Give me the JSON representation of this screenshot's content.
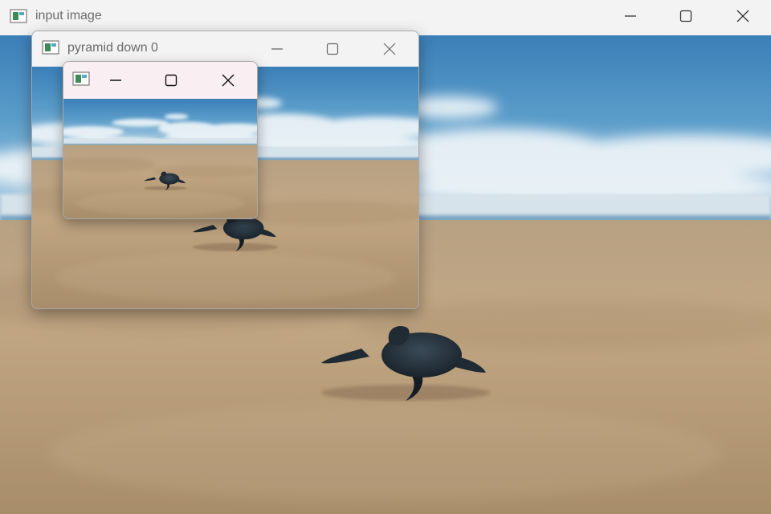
{
  "windows": {
    "main": {
      "title": "input image"
    },
    "pyramid0": {
      "title": "pyramid down 0"
    },
    "pyramid1": {
      "title": ""
    }
  },
  "controls": {
    "minimize": "minimize",
    "maximize": "maximize",
    "close": "close"
  },
  "icons": {
    "app": "image-window-icon",
    "minimize": "minimize-icon",
    "maximize": "maximize-icon",
    "close": "close-icon"
  },
  "image": {
    "subject": "sea turtle hatchling on sandy beach under cloudy blue sky"
  },
  "colors": {
    "titlebar": "#f3f3f3",
    "titlebar_active_small": "#f9eef2",
    "title_text": "#6b6b6b",
    "sky": "#3f86bf",
    "sand": "#b49876"
  }
}
